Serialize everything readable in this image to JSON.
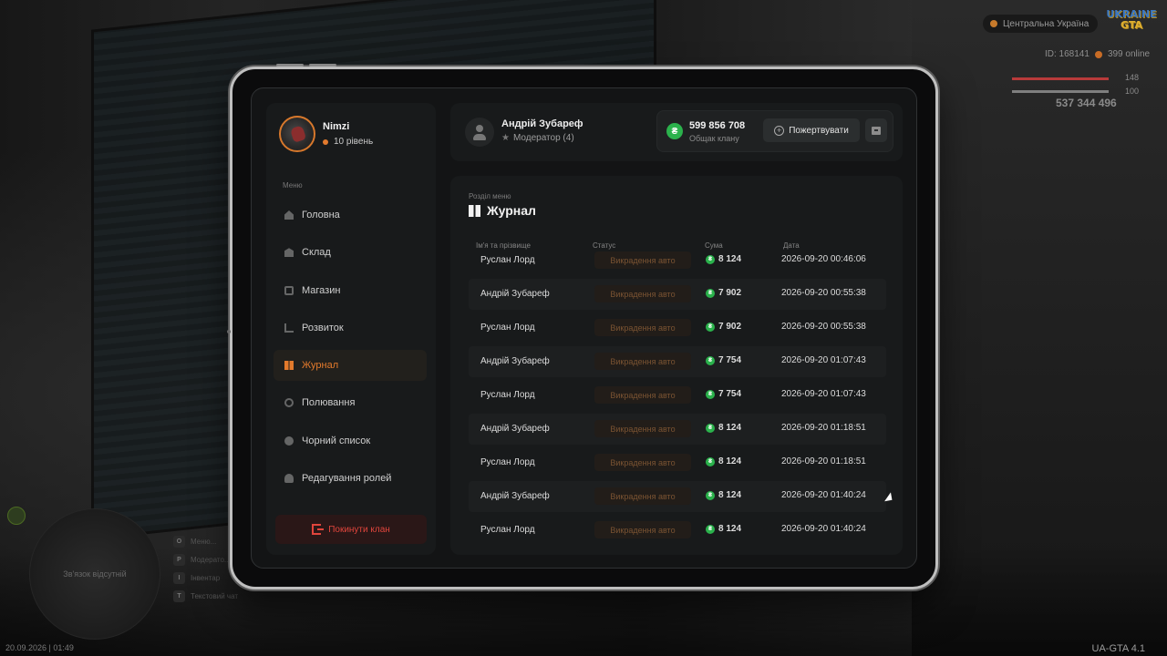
{
  "hud": {
    "region": "Центральна Україна",
    "logo_top": "UKRAINE",
    "logo_bottom": "GTA",
    "player_id": "ID: 168141",
    "online": "399 online",
    "health": "148",
    "armor": "100",
    "money": "537 344 496",
    "datetime": "20.09.2026 | 01:49",
    "version": "UA-GTA 4.1",
    "minimap_text": "Зв'язок відсутній",
    "hints": [
      {
        "key": "O",
        "label": "Меню..."
      },
      {
        "key": "P",
        "label": "Модерато..."
      },
      {
        "key": "I",
        "label": "Інвентар"
      },
      {
        "key": "T",
        "label": "Текстовий чат"
      }
    ]
  },
  "profile": {
    "name": "Nimzi",
    "level": "10 рівень"
  },
  "menu": {
    "caption": "Меню",
    "items": [
      {
        "label": "Головна",
        "icon": "home-icon"
      },
      {
        "label": "Склад",
        "icon": "warehouse-icon"
      },
      {
        "label": "Магазин",
        "icon": "shop-icon"
      },
      {
        "label": "Розвиток",
        "icon": "growth-icon"
      },
      {
        "label": "Журнал",
        "icon": "journal-icon",
        "active": true
      },
      {
        "label": "Полювання",
        "icon": "hunt-icon"
      },
      {
        "label": "Чорний список",
        "icon": "blacklist-icon"
      },
      {
        "label": "Редагування ролей",
        "icon": "roles-icon"
      }
    ],
    "leave_label": "Покинути клан"
  },
  "header": {
    "user_name": "Андрій Зубареф",
    "user_role": "Модератор (4)",
    "bank_amount": "599 856 708",
    "bank_label": "Общак клану",
    "donate_label": "Пожертвувати",
    "currency_symbol": "₴"
  },
  "journal": {
    "caption": "Розділ меню",
    "title": "Журнал",
    "columns": {
      "name": "Ім'я та прізвище",
      "status": "Статус",
      "sum": "Сума",
      "date": "Дата"
    },
    "rows": [
      {
        "name": "Руслан Лорд",
        "status": "Викрадення авто",
        "sum": "8 124",
        "date": "2026-09-20 00:46:06"
      },
      {
        "name": "Андрій Зубареф",
        "status": "Викрадення авто",
        "sum": "7 902",
        "date": "2026-09-20 00:55:38"
      },
      {
        "name": "Руслан Лорд",
        "status": "Викрадення авто",
        "sum": "7 902",
        "date": "2026-09-20 00:55:38"
      },
      {
        "name": "Андрій Зубареф",
        "status": "Викрадення авто",
        "sum": "7 754",
        "date": "2026-09-20 01:07:43"
      },
      {
        "name": "Руслан Лорд",
        "status": "Викрадення авто",
        "sum": "7 754",
        "date": "2026-09-20 01:07:43"
      },
      {
        "name": "Андрій Зубареф",
        "status": "Викрадення авто",
        "sum": "8 124",
        "date": "2026-09-20 01:18:51"
      },
      {
        "name": "Руслан Лорд",
        "status": "Викрадення авто",
        "sum": "8 124",
        "date": "2026-09-20 01:18:51"
      },
      {
        "name": "Андрій Зубареф",
        "status": "Викрадення авто",
        "sum": "8 124",
        "date": "2026-09-20 01:40:24"
      },
      {
        "name": "Руслан Лорд",
        "status": "Викрадення авто",
        "sum": "8 124",
        "date": "2026-09-20 01:40:24"
      }
    ]
  },
  "colors": {
    "accent": "#e37a2c",
    "danger": "#e0453c",
    "currency": "#2bb24c",
    "panel": "#181a1b"
  }
}
